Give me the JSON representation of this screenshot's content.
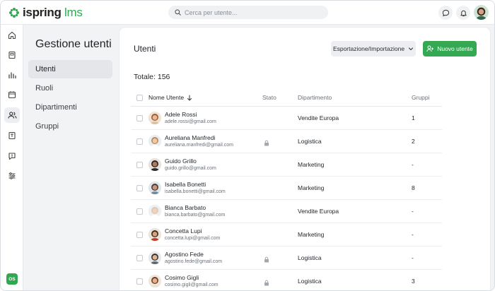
{
  "app": {
    "logo_bold": "ispring",
    "logo_light": " lms",
    "brand_color": "#2fa84f"
  },
  "search": {
    "placeholder": "Cerca per utente..."
  },
  "rail": {
    "items": [
      "home-icon",
      "book-icon",
      "chart-icon",
      "calendar-icon",
      "users-icon",
      "doc-icon",
      "message-icon",
      "sliders-icon"
    ],
    "active": "users-icon",
    "user_initials": "OS"
  },
  "subnav": {
    "title": "Gestione utenti",
    "items": [
      {
        "label": "Utenti",
        "active": true
      },
      {
        "label": "Ruoli",
        "active": false
      },
      {
        "label": "Dipartimenti",
        "active": false
      },
      {
        "label": "Gruppi",
        "active": false
      }
    ]
  },
  "main": {
    "title": "Utenti",
    "export_label": "Esportazione/Importazione",
    "new_user_label": "Nuovo utente",
    "total": "Totale: 156",
    "columns": {
      "name": "Nome Utente",
      "status": "Stato",
      "department": "Dipartimento",
      "groups": "Gruppi"
    },
    "rows": [
      {
        "name": "Adele Rossi",
        "email": "adele.rossi@gmail.com",
        "locked": false,
        "department": "Vendite Europa",
        "groups": "1",
        "avatar": {
          "bg": "#f1e3d3",
          "hair": "#9c5b2e",
          "skin": "#e8b899",
          "shirt": "#d8c3a5"
        }
      },
      {
        "name": "Aureliana Manfredi",
        "email": "aureliana.manfredi@gmail.com",
        "locked": true,
        "department": "Logistica",
        "groups": "2",
        "avatar": {
          "bg": "#e9eef2",
          "hair": "#b98a5a",
          "skin": "#f0c9a8",
          "shirt": "#ffffff"
        }
      },
      {
        "name": "Guido Grillo",
        "email": "guido.grillo@gmail.com",
        "locked": false,
        "department": "Marketing",
        "groups": "-",
        "avatar": {
          "bg": "#e7e2db",
          "hair": "#2d2220",
          "skin": "#b07a5c",
          "shirt": "#2a2a2a"
        }
      },
      {
        "name": "Isabella Bonetti",
        "email": "isabella.bonetti@gmail.com",
        "locked": false,
        "department": "Marketing",
        "groups": "8",
        "avatar": {
          "bg": "#dfe6ea",
          "hair": "#4a3a33",
          "skin": "#c9977a",
          "shirt": "#6f8ca3"
        }
      },
      {
        "name": "Bianca Barbato",
        "email": "bianca.barbato@gmail.com",
        "locked": false,
        "department": "Vendite Europa",
        "groups": "-",
        "avatar": {
          "bg": "#eef0f2",
          "hair": "#d9c9b6",
          "skin": "#f3d2bb",
          "shirt": "#ffffff"
        }
      },
      {
        "name": "Concetta Lupi",
        "email": "concetta.lupi@gmail.com",
        "locked": false,
        "department": "Marketing",
        "groups": "-",
        "avatar": {
          "bg": "#ece4da",
          "hair": "#3a2a22",
          "skin": "#d8a27f",
          "shirt": "#c0392b"
        }
      },
      {
        "name": "Agostino Fede",
        "email": "agostino.fede@gmail.com",
        "locked": true,
        "department": "Logistica",
        "groups": "-",
        "avatar": {
          "bg": "#e6e9ec",
          "hair": "#3b2f2a",
          "skin": "#e3b595",
          "shirt": "#5a6b78"
        }
      },
      {
        "name": "Cosimo Gigli",
        "email": "cosimo.gigli@gmail.com",
        "locked": true,
        "department": "Logistica",
        "groups": "3",
        "avatar": {
          "bg": "#efe7dc",
          "hair": "#6b3e24",
          "skin": "#e7b08c",
          "shirt": "#e8e2d8"
        }
      }
    ]
  }
}
